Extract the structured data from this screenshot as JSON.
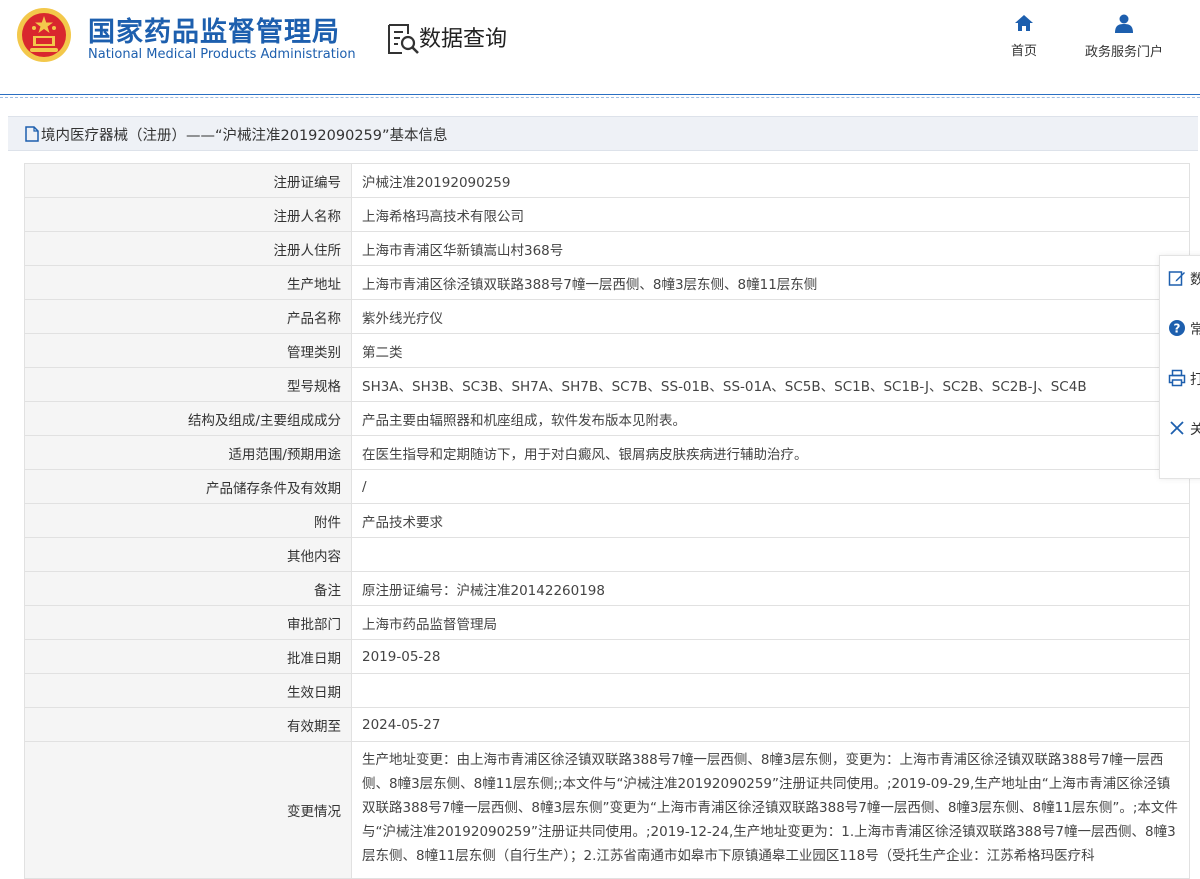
{
  "header": {
    "org_cn": "国家药品监督管理局",
    "org_en": "National Medical Products Administration",
    "query_title": "数据查询",
    "nav": {
      "home": "首页",
      "portal": "政务服务门户"
    }
  },
  "page_title": "境内医疗器械（注册）——“沪械注准20192090259”基本信息",
  "rows": [
    {
      "k": "注册证编号",
      "v": "沪械注准20192090259"
    },
    {
      "k": "注册人名称",
      "v": "上海希格玛高技术有限公司"
    },
    {
      "k": "注册人住所",
      "v": "上海市青浦区华新镇嵩山村368号"
    },
    {
      "k": "生产地址",
      "v": "上海市青浦区徐泾镇双联路388号7幢一层西侧、8幢3层东侧、8幢11层东侧"
    },
    {
      "k": "产品名称",
      "v": "紫外线光疗仪"
    },
    {
      "k": "管理类别",
      "v": "第二类"
    },
    {
      "k": "型号规格",
      "v": "SH3A、SH3B、SC3B、SH7A、SH7B、SC7B、SS-01B、SS-01A、SC5B、SC1B、SC1B-J、SC2B、SC2B-J、SC4B"
    },
    {
      "k": "结构及组成/主要组成成分",
      "v": "产品主要由辐照器和机座组成，软件发布版本见附表。"
    },
    {
      "k": "适用范围/预期用途",
      "v": "在医生指导和定期随访下，用于对白癜风、银屑病皮肤疾病进行辅助治疗。"
    },
    {
      "k": "产品储存条件及有效期",
      "v": "/"
    },
    {
      "k": "附件",
      "v": "产品技术要求"
    },
    {
      "k": "其他内容",
      "v": ""
    },
    {
      "k": "备注",
      "v": "原注册证编号：沪械注准20142260198"
    },
    {
      "k": "审批部门",
      "v": "上海市药品监督管理局"
    },
    {
      "k": "批准日期",
      "v": "2019-05-28"
    },
    {
      "k": "生效日期",
      "v": ""
    },
    {
      "k": "有效期至",
      "v": "2024-05-27"
    },
    {
      "k": "变更情况",
      "v": "生产地址变更：由上海市青浦区徐泾镇双联路388号7幢一层西侧、8幢3层东侧，变更为：上海市青浦区徐泾镇双联路388号7幢一层西侧、8幢3层东侧、8幢11层东侧;;本文件与“沪械注准20192090259”注册证共同使用。;2019-09-29,生产地址由“上海市青浦区徐泾镇双联路388号7幢一层西侧、8幢3层东侧”变更为“上海市青浦区徐泾镇双联路388号7幢一层西侧、8幢3层东侧、8幢11层东侧”。;本文件与“沪械注准20192090259”注册证共同使用。;2019-12-24,生产地址变更为：1.上海市青浦区徐泾镇双联路388号7幢一层西侧、8幢3层东侧、8幢11层东侧（自行生产）；2.江苏省南通市如皋市下原镇通皋工业园区118号（受托生产企业：江苏希格玛医疗科"
    }
  ],
  "float_panel": [
    "数",
    "常",
    "打",
    "关"
  ],
  "colors": {
    "brand_blue": "#1d5fae",
    "title_bar_bg": "#eef1f6",
    "label_bg": "#f5f5f5"
  }
}
